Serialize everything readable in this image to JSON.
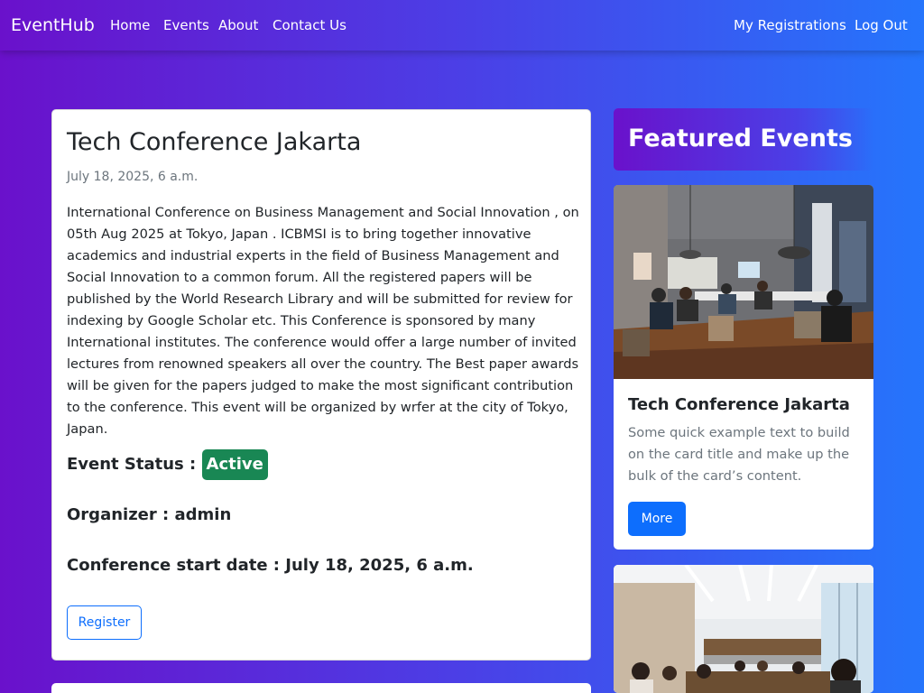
{
  "nav": {
    "brand": "EventHub",
    "links": [
      "Home",
      "Events",
      "About",
      "Contact Us"
    ],
    "right_links": [
      "My Registrations",
      "Log Out"
    ]
  },
  "event": {
    "title": "Tech Conference Jakarta",
    "date": "July 18, 2025, 6 a.m.",
    "description": "International Conference on Business Management and Social Innovation , on 05th Aug 2025 at Tokyo, Japan . ICBMSI is to bring together innovative academics and industrial experts in the field of Business Management and Social Innovation to a common forum. All the registered papers will be published by the World Research Library and will be submitted for review for indexing by Google Scholar etc. This Conference is sponsored by many International institutes. The conference would offer a large number of invited lectures from renowned speakers all over the country. The Best paper awards will be given for the papers judged to make the most significant contribution to the conference. This event will be organized by wrfer at the city of Tokyo, Japan.",
    "status_label": "Event Status :",
    "status_value": "Active",
    "status_color": "#198754",
    "organizer_label": "Organizer :",
    "organizer_value": "admin",
    "start_label": "Conference start date :",
    "start_value": "July 18, 2025, 6 a.m.",
    "register_label": "Register"
  },
  "featured": {
    "heading": "Featured Events",
    "cards": [
      {
        "title": "Tech Conference Jakarta",
        "text": "Some quick example text to build on the card title and make up the bulk of the card’s content.",
        "button": "More"
      }
    ]
  },
  "colors": {
    "gradient_start": "#6a11cb",
    "gradient_end": "#2575fc",
    "primary": "#0d6efd",
    "success": "#198754"
  }
}
